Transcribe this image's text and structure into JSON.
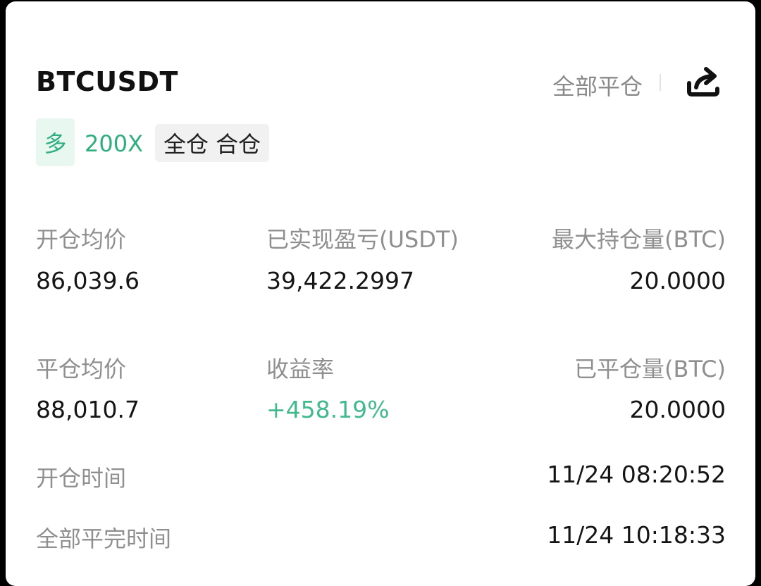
{
  "header": {
    "symbol": "BTCUSDT",
    "close_all_label": "全部平仓",
    "share_icon": "share-icon"
  },
  "tags": {
    "direction": "多",
    "leverage": "200X",
    "margin_mode": "全仓 合仓"
  },
  "stats": {
    "avg_open_price_label": "开仓均价",
    "avg_open_price": "86,039.6",
    "realized_pnl_label": "已实现盈亏(USDT)",
    "realized_pnl": "39,422.2997",
    "max_position_label": "最大持仓量(BTC)",
    "max_position": "20.0000",
    "avg_close_price_label": "平仓均价",
    "avg_close_price": "88,010.7",
    "roi_label": "收益率",
    "roi": "+458.19%",
    "closed_position_label": "已平仓量(BTC)",
    "closed_position": "20.0000"
  },
  "times": {
    "open_time_label": "开仓时间",
    "open_time": "11/24 08:20:52",
    "close_time_label": "全部平完时间",
    "close_time": "11/24 10:18:33"
  },
  "colors": {
    "accent_green": "#43b98e",
    "tag_bg": "#e8f7f0"
  }
}
